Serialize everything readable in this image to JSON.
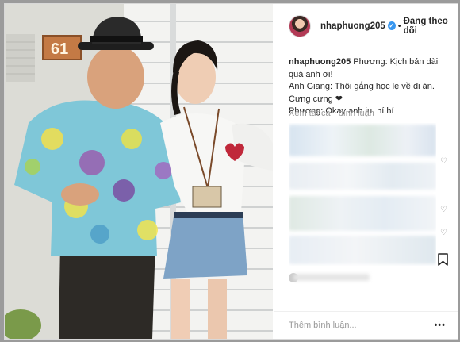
{
  "header": {
    "username": "nhaphuong205",
    "verified_mark": "✓",
    "separator": "•",
    "follow_status": "Đang theo dõi"
  },
  "caption": {
    "username": "nhaphuong205",
    "line1": "Phương: Kịch bản dài quá anh ơi!",
    "line2": "Anh Giang: Thôi gắng học lẹ về đi ăn. Cưng cưng ❤",
    "line3": "Phương: Okay anh iu, hí hí"
  },
  "comments": {
    "view_all_label": "Xem tất cả",
    "comments_label": "bình luận"
  },
  "footer": {
    "add_comment_placeholder": "Thêm bình luận...",
    "more_label": "•••"
  },
  "photo": {
    "house_number": "61"
  },
  "icons": {
    "heart": "heart-icon",
    "bookmark": "bookmark-icon",
    "more": "more-options-icon"
  },
  "colors": {
    "verified_blue": "#3897f0",
    "text_primary": "#262626",
    "text_secondary": "#999999"
  }
}
